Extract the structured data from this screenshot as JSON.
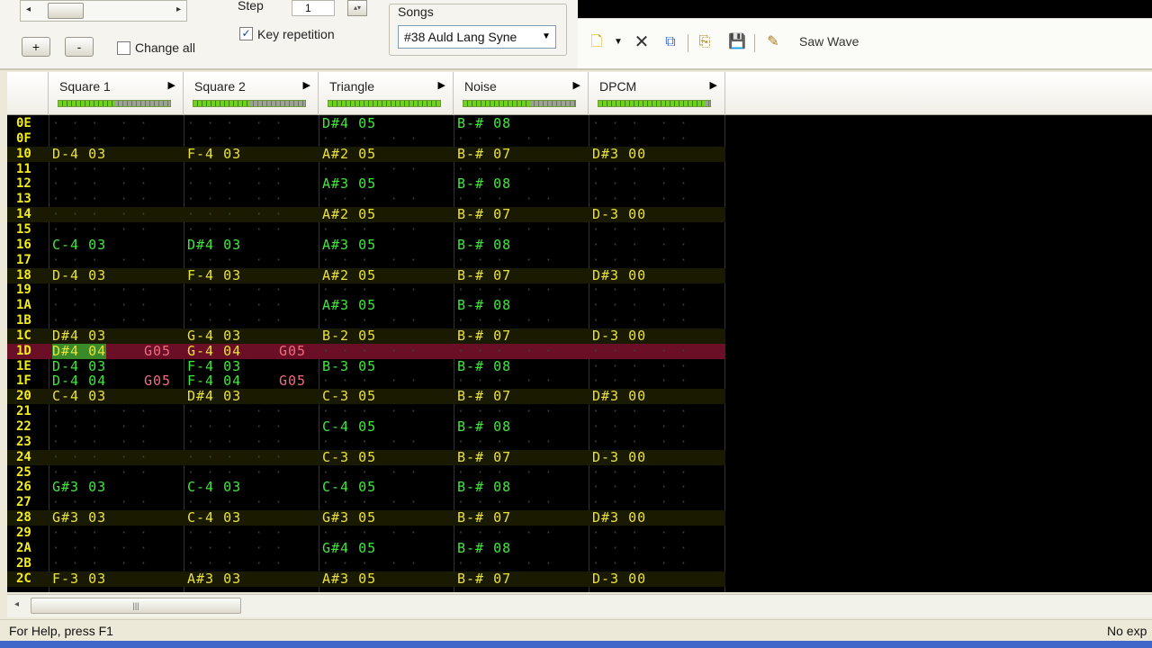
{
  "toolbar": {
    "step_label": "Step",
    "step_value": "1",
    "key_repetition_label": "Key repetition",
    "key_repetition_checked": true,
    "change_all_label": "Change all",
    "change_all_checked": false,
    "add_label": "+",
    "remove_label": "-",
    "songs_label": "Songs",
    "song_selected": "#38 Auld Lang Syne",
    "instrument_name": "Saw Wave",
    "icons": [
      "new-document-icon",
      "dropdown-arrow-icon",
      "delete-icon",
      "clone-icon",
      "load-icon",
      "save-icon",
      "edit-icon"
    ]
  },
  "channels": [
    {
      "name": "Square 1",
      "volume": 0.5
    },
    {
      "name": "Square 2",
      "volume": 0.5
    },
    {
      "name": "Triangle",
      "volume": 1.0
    },
    {
      "name": "Noise",
      "volume": 0.6
    },
    {
      "name": "DPCM",
      "volume": 0.95
    }
  ],
  "rows": [
    {
      "id": "0E",
      "cells": [
        "",
        "",
        "D#4 05",
        "B-# 08",
        ""
      ]
    },
    {
      "id": "0F",
      "cells": [
        "",
        "",
        "",
        "",
        ""
      ]
    },
    {
      "id": "10",
      "cells": [
        "D-4 03",
        "F-4 03",
        "A#2 05",
        "B-# 07",
        "D#3 00"
      ]
    },
    {
      "id": "11",
      "cells": [
        "",
        "",
        "",
        "",
        ""
      ]
    },
    {
      "id": "12",
      "cells": [
        "",
        "",
        "A#3 05",
        "B-# 08",
        ""
      ]
    },
    {
      "id": "13",
      "cells": [
        "",
        "",
        "",
        "",
        ""
      ]
    },
    {
      "id": "14",
      "cells": [
        "",
        "",
        "A#2 05",
        "B-# 07",
        "D-3 00"
      ]
    },
    {
      "id": "15",
      "cells": [
        "",
        "",
        "",
        "",
        ""
      ]
    },
    {
      "id": "16",
      "cells": [
        "C-4 03",
        "D#4 03",
        "A#3 05",
        "B-# 08",
        ""
      ]
    },
    {
      "id": "17",
      "cells": [
        "",
        "",
        "",
        "",
        ""
      ]
    },
    {
      "id": "18",
      "cells": [
        "D-4 03",
        "F-4 03",
        "A#2 05",
        "B-# 07",
        "D#3 00"
      ]
    },
    {
      "id": "19",
      "cells": [
        "",
        "",
        "",
        "",
        ""
      ]
    },
    {
      "id": "1A",
      "cells": [
        "",
        "",
        "A#3 05",
        "B-# 08",
        ""
      ]
    },
    {
      "id": "1B",
      "cells": [
        "",
        "",
        "",
        "",
        ""
      ]
    },
    {
      "id": "1C",
      "cells": [
        "D#4 03",
        "G-4 03",
        "B-2 05",
        "B-# 07",
        "D-3 00"
      ]
    },
    {
      "id": "1D",
      "cells": [
        "D#4 04",
        "G-4 04",
        "",
        "",
        ""
      ],
      "fx": [
        "G05",
        "G05",
        "",
        "",
        ""
      ]
    },
    {
      "id": "1E",
      "cells": [
        "D-4 03",
        "F-4 03",
        "B-3 05",
        "B-# 08",
        ""
      ]
    },
    {
      "id": "1F",
      "cells": [
        "D-4 04",
        "F-4 04",
        "",
        "",
        ""
      ],
      "fx": [
        "G05",
        "G05",
        "",
        "",
        ""
      ]
    },
    {
      "id": "20",
      "cells": [
        "C-4 03",
        "D#4 03",
        "C-3 05",
        "B-# 07",
        "D#3 00"
      ]
    },
    {
      "id": "21",
      "cells": [
        "",
        "",
        "",
        "",
        ""
      ]
    },
    {
      "id": "22",
      "cells": [
        "",
        "",
        "C-4 05",
        "B-# 08",
        ""
      ]
    },
    {
      "id": "23",
      "cells": [
        "",
        "",
        "",
        "",
        ""
      ]
    },
    {
      "id": "24",
      "cells": [
        "",
        "",
        "C-3 05",
        "B-# 07",
        "D-3 00"
      ]
    },
    {
      "id": "25",
      "cells": [
        "",
        "",
        "",
        "",
        ""
      ]
    },
    {
      "id": "26",
      "cells": [
        "G#3 03",
        "C-4 03",
        "C-4 05",
        "B-# 08",
        ""
      ]
    },
    {
      "id": "27",
      "cells": [
        "",
        "",
        "",
        "",
        ""
      ]
    },
    {
      "id": "28",
      "cells": [
        "G#3 03",
        "C-4 03",
        "G#3 05",
        "B-# 07",
        "D#3 00"
      ]
    },
    {
      "id": "29",
      "cells": [
        "",
        "",
        "",
        "",
        ""
      ]
    },
    {
      "id": "2A",
      "cells": [
        "",
        "",
        "G#4 05",
        "B-# 08",
        ""
      ]
    },
    {
      "id": "2B",
      "cells": [
        "",
        "",
        "",
        "",
        ""
      ]
    },
    {
      "id": "2C",
      "cells": [
        "F-3 03",
        "A#3 03",
        "A#3 05",
        "B-# 07",
        "D-3 00"
      ]
    }
  ],
  "status": {
    "help_text": "For Help, press F1",
    "right_text": "No exp"
  },
  "colors": {
    "row_number": "#f2ec1e",
    "note_highlight": "#e8e23a",
    "note_normal": "#3ee83a",
    "effect": "#ee6c7e",
    "cursor_row": "#6a0f26"
  }
}
